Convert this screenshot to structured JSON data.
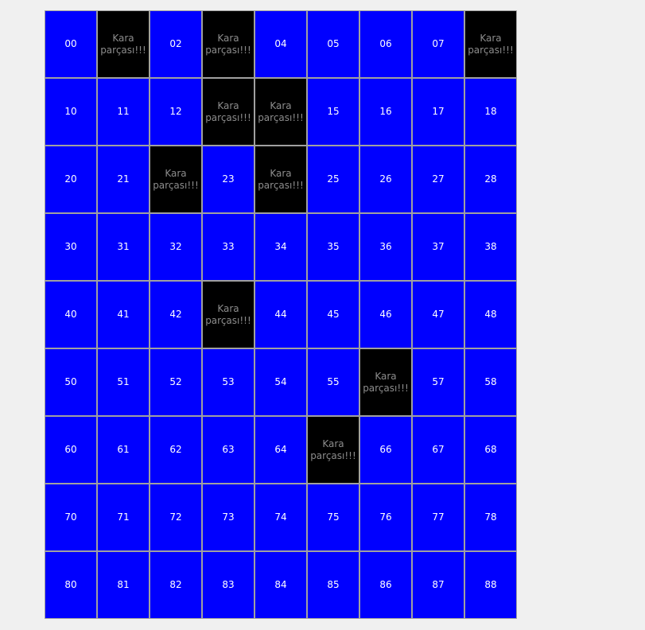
{
  "window": {
    "background": "#f0f0f0"
  },
  "colors": {
    "water": "#0000ff",
    "water_text": "#ffffff",
    "land": "#000000",
    "land_text": "#8c8c8c",
    "border": "#a0a0a0"
  },
  "land_label": "Kara\nparçası!!!",
  "grid": {
    "rows": 9,
    "cols": 9,
    "cells": [
      [
        {
          "label": "00",
          "land": false
        },
        {
          "label": "Kara\nparçası!!!",
          "land": true
        },
        {
          "label": "02",
          "land": false
        },
        {
          "label": "Kara\nparçası!!!",
          "land": true
        },
        {
          "label": "04",
          "land": false
        },
        {
          "label": "05",
          "land": false
        },
        {
          "label": "06",
          "land": false
        },
        {
          "label": "07",
          "land": false
        },
        {
          "label": "Kara\nparçası!!!",
          "land": true
        }
      ],
      [
        {
          "label": "10",
          "land": false
        },
        {
          "label": "11",
          "land": false
        },
        {
          "label": "12",
          "land": false
        },
        {
          "label": "Kara\nparçası!!!",
          "land": true
        },
        {
          "label": "Kara\nparçası!!!",
          "land": true
        },
        {
          "label": "15",
          "land": false
        },
        {
          "label": "16",
          "land": false
        },
        {
          "label": "17",
          "land": false
        },
        {
          "label": "18",
          "land": false
        }
      ],
      [
        {
          "label": "20",
          "land": false
        },
        {
          "label": "21",
          "land": false
        },
        {
          "label": "Kara\nparçası!!!",
          "land": true
        },
        {
          "label": "23",
          "land": false
        },
        {
          "label": "Kara\nparçası!!!",
          "land": true
        },
        {
          "label": "25",
          "land": false
        },
        {
          "label": "26",
          "land": false
        },
        {
          "label": "27",
          "land": false
        },
        {
          "label": "28",
          "land": false
        }
      ],
      [
        {
          "label": "30",
          "land": false
        },
        {
          "label": "31",
          "land": false
        },
        {
          "label": "32",
          "land": false
        },
        {
          "label": "33",
          "land": false
        },
        {
          "label": "34",
          "land": false
        },
        {
          "label": "35",
          "land": false
        },
        {
          "label": "36",
          "land": false
        },
        {
          "label": "37",
          "land": false
        },
        {
          "label": "38",
          "land": false
        }
      ],
      [
        {
          "label": "40",
          "land": false
        },
        {
          "label": "41",
          "land": false
        },
        {
          "label": "42",
          "land": false
        },
        {
          "label": "Kara\nparçası!!!",
          "land": true
        },
        {
          "label": "44",
          "land": false
        },
        {
          "label": "45",
          "land": false
        },
        {
          "label": "46",
          "land": false
        },
        {
          "label": "47",
          "land": false
        },
        {
          "label": "48",
          "land": false
        }
      ],
      [
        {
          "label": "50",
          "land": false
        },
        {
          "label": "51",
          "land": false
        },
        {
          "label": "52",
          "land": false
        },
        {
          "label": "53",
          "land": false
        },
        {
          "label": "54",
          "land": false
        },
        {
          "label": "55",
          "land": false
        },
        {
          "label": "Kara\nparçası!!!",
          "land": true
        },
        {
          "label": "57",
          "land": false
        },
        {
          "label": "58",
          "land": false
        }
      ],
      [
        {
          "label": "60",
          "land": false
        },
        {
          "label": "61",
          "land": false
        },
        {
          "label": "62",
          "land": false
        },
        {
          "label": "63",
          "land": false
        },
        {
          "label": "64",
          "land": false
        },
        {
          "label": "Kara\nparçası!!!",
          "land": true
        },
        {
          "label": "66",
          "land": false
        },
        {
          "label": "67",
          "land": false
        },
        {
          "label": "68",
          "land": false
        }
      ],
      [
        {
          "label": "70",
          "land": false
        },
        {
          "label": "71",
          "land": false
        },
        {
          "label": "72",
          "land": false
        },
        {
          "label": "73",
          "land": false
        },
        {
          "label": "74",
          "land": false
        },
        {
          "label": "75",
          "land": false
        },
        {
          "label": "76",
          "land": false
        },
        {
          "label": "77",
          "land": false
        },
        {
          "label": "78",
          "land": false
        }
      ],
      [
        {
          "label": "80",
          "land": false
        },
        {
          "label": "81",
          "land": false
        },
        {
          "label": "82",
          "land": false
        },
        {
          "label": "83",
          "land": false
        },
        {
          "label": "84",
          "land": false
        },
        {
          "label": "85",
          "land": false
        },
        {
          "label": "86",
          "land": false
        },
        {
          "label": "87",
          "land": false
        },
        {
          "label": "88",
          "land": false
        }
      ]
    ]
  }
}
